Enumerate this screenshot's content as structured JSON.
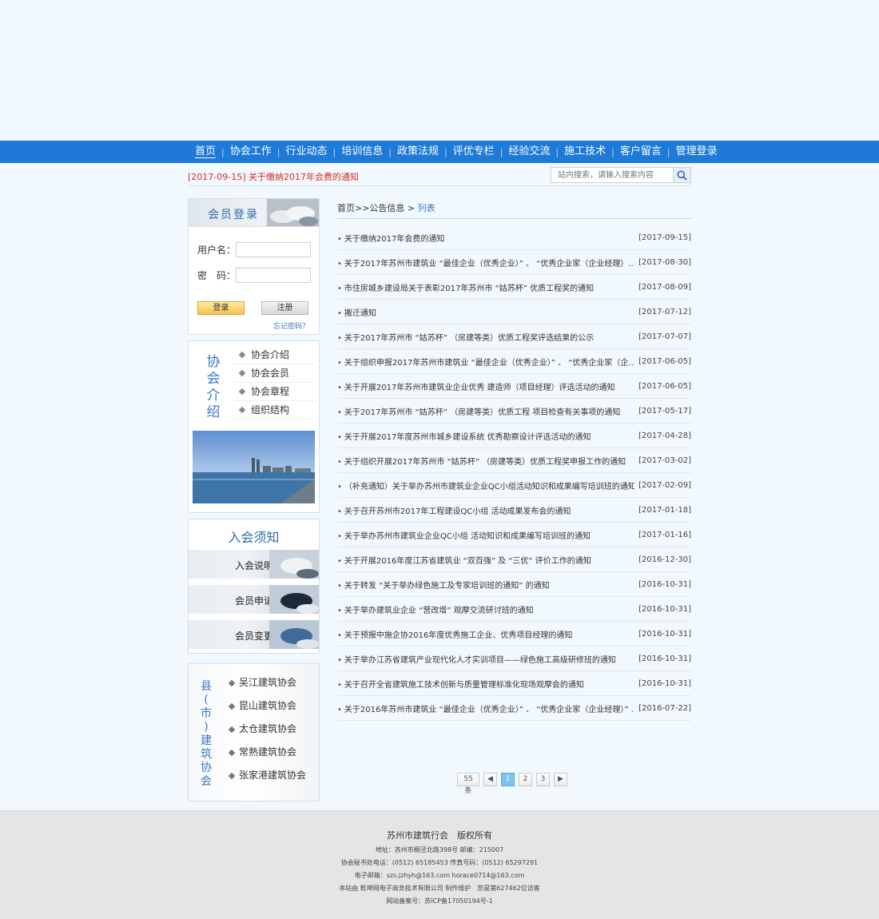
{
  "nav": {
    "items": [
      {
        "label": "首页",
        "active": true
      },
      {
        "label": "协会工作"
      },
      {
        "label": "行业动态"
      },
      {
        "label": "培训信息"
      },
      {
        "label": "政策法规"
      },
      {
        "label": "评优专栏"
      },
      {
        "label": "经验交流"
      },
      {
        "label": "施工技术"
      },
      {
        "label": "客户留言"
      },
      {
        "label": "管理登录"
      }
    ],
    "separator": "|"
  },
  "notice": {
    "text": "[2017-09-15] 关于缴纳2017年会费的通知"
  },
  "search": {
    "placeholder": "站内搜索，请输入搜索内容"
  },
  "login": {
    "title": "会员登录",
    "username_label": "用户名：",
    "password_label": "密　码：",
    "login_button": "登录",
    "register_button": "注册",
    "forgot_link": "忘记密码？"
  },
  "about": {
    "vertical_title": [
      "协",
      "会",
      "介",
      "绍"
    ],
    "links": [
      "协会介绍",
      "协会会员",
      "协会章程",
      "组织结构"
    ]
  },
  "join": {
    "title": "入会须知",
    "items": [
      "入会说明",
      "会员申请",
      "会员变更"
    ]
  },
  "county": {
    "vertical_title": [
      "县",
      "(",
      "市",
      ")",
      "建",
      "筑",
      "协",
      "会"
    ],
    "links": [
      "吴江建筑协会",
      "昆山建筑协会",
      "太仓建筑协会",
      "常熟建筑协会",
      "张家港建筑协会"
    ]
  },
  "breadcrumb": {
    "path": "首页>>公告信息 >",
    "current": " 列表"
  },
  "news": [
    {
      "title": "关于缴纳2017年会费的通知",
      "date": "[2017-09-15]"
    },
    {
      "title": "关于2017年苏州市建筑业 “最佳企业（优秀企业）” 、 “优秀企业家（企业经理）...",
      "date": "[2017-08-30]"
    },
    {
      "title": "市住房城乡建设局关于表彰2017年苏州市 “姑苏杯” 优质工程奖的通知",
      "date": "[2017-08-09]"
    },
    {
      "title": "搬迁通知",
      "date": "[2017-07-12]"
    },
    {
      "title": "关于2017年苏州市 “姑苏杯” （房建等类）优质工程奖评选结果的公示",
      "date": "[2017-07-07]"
    },
    {
      "title": "关于组织申报2017年苏州市建筑业 “最佳企业（优秀企业）” 、 “优秀企业家（企...",
      "date": "[2017-06-05]"
    },
    {
      "title": "关于开展2017年苏州市建筑业企业优秀 建造师（项目经理）评选活动的通知",
      "date": "[2017-06-05]"
    },
    {
      "title": "关于2017年苏州市 “姑苏杯” （房建等类）优质工程 项目检查有关事项的通知",
      "date": "[2017-05-17]"
    },
    {
      "title": "关于开展2017年度苏州市城乡建设系统 优秀勘察设计评选活动的通知",
      "date": "[2017-04-28]"
    },
    {
      "title": "关于组织开展2017年苏州市 “姑苏杯” （房建等类）优质工程奖申报工作的通知",
      "date": "[2017-03-02]"
    },
    {
      "title": "（补充通知）关于举办苏州市建筑业企业QC小组活动知识和成果编写培训班的通知",
      "date": "[2017-02-09]"
    },
    {
      "title": "关于召开苏州市2017年工程建设QC小组 活动成果发布会的通知",
      "date": "[2017-01-18]"
    },
    {
      "title": "关于举办苏州市建筑业企业QC小组 活动知识和成果编写培训班的通知",
      "date": "[2017-01-16]"
    },
    {
      "title": "关于开展2016年度江苏省建筑业 “双百强” 及 “三优” 评价工作的通知",
      "date": "[2016-12-30]"
    },
    {
      "title": "关于转发 “关于举办绿色施工及专家培训班的通知” 的通知",
      "date": "[2016-10-31]"
    },
    {
      "title": "关于举办建筑业企业 “营改增” 观摩交流研讨班的通知",
      "date": "[2016-10-31]"
    },
    {
      "title": "关于预报中施企协2016年度优秀施工企业、优秀项目经理的通知",
      "date": "[2016-10-31]"
    },
    {
      "title": "关于举办江苏省建筑产业现代化人才实训项目——绿色施工高级研修班的通知",
      "date": "[2016-10-31]"
    },
    {
      "title": "关于召开全省建筑施工技术创新与质量管理标准化现场观摩会的通知",
      "date": "[2016-10-31]"
    },
    {
      "title": "关于2016年苏州市建筑业 “最佳企业（优秀企业）” 、 “优秀企业家（企业经理）” ...",
      "date": "[2016-07-22]"
    }
  ],
  "pager": {
    "count": "55条",
    "prev": "◀",
    "pages": [
      "1",
      "2",
      "3"
    ],
    "current": "1",
    "next": "▶"
  },
  "footer": {
    "main": "苏州市建筑行会　版权所有",
    "lines": [
      "地址：苏州市桐泾北路398号 邮编：215007",
      "协会秘书处电话：(0512) 65185453 传真号码：(0512) 65297291",
      "电子邮箱：szs.jzhyh@163.com horace0714@163.com",
      "本站由 乾坤网电子商务技术有限公司 制作维护　您是第627462位访客",
      "网站备案号：苏ICP备17050194号-1"
    ]
  },
  "colors": {
    "nav_bg": "#1e7ad6",
    "notice": "#d62b2b",
    "accent_blue": "#3a78c2",
    "pager_active": "#7cc3f0"
  }
}
